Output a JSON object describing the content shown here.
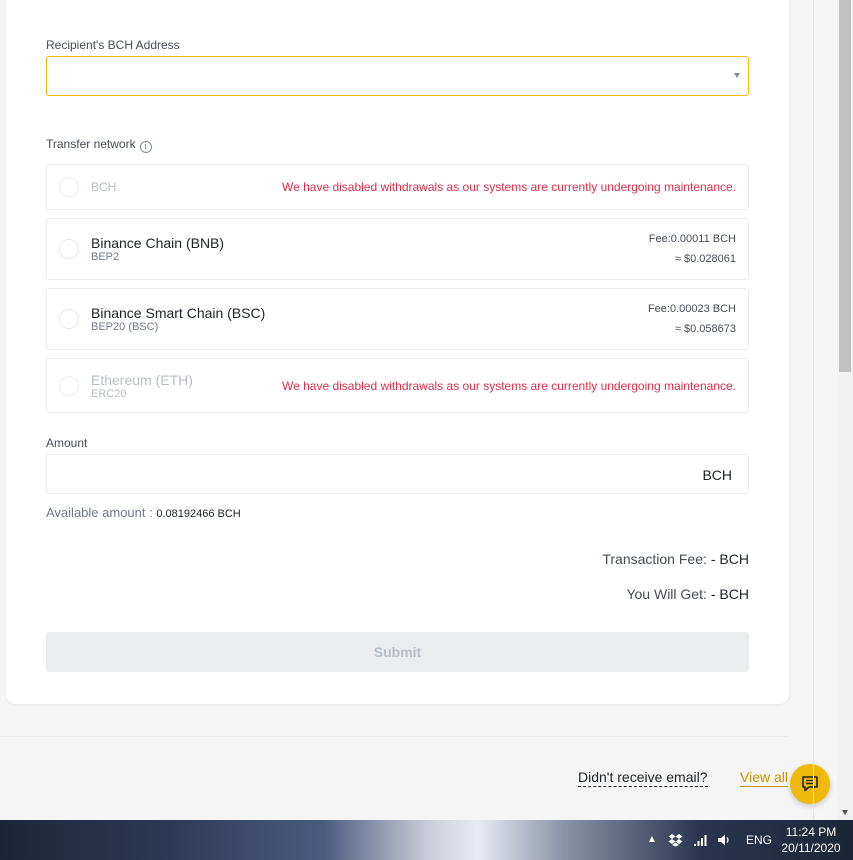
{
  "form": {
    "address_label": "Recipient's BCH Address",
    "address_value": "",
    "network_label": "Transfer network",
    "networks": [
      {
        "name": "BCH",
        "sub": "",
        "disabled": true,
        "warning": "We have disabled withdrawals as our systems are currently undergoing maintenance.",
        "fee": "",
        "fee_usd": ""
      },
      {
        "name": "Binance Chain (BNB)",
        "sub": "BEP2",
        "disabled": false,
        "warning": "",
        "fee": "Fee:0.00011 BCH",
        "fee_usd": "≈ $0.028061"
      },
      {
        "name": "Binance Smart Chain (BSC)",
        "sub": "BEP20 (BSC)",
        "disabled": false,
        "warning": "",
        "fee": "Fee:0.00023 BCH",
        "fee_usd": "≈ $0.058673"
      },
      {
        "name": "Ethereum (ETH)",
        "sub": "ERC20",
        "disabled": true,
        "warning": "We have disabled withdrawals as our systems are currently undergoing maintenance.",
        "fee": "",
        "fee_usd": ""
      }
    ],
    "amount_label": "Amount",
    "amount_unit": "BCH",
    "available_label": "Available amount :",
    "available_value": "0.08192466 BCH",
    "tx_fee_label": "Transaction Fee:",
    "tx_fee_value": "- BCH",
    "you_get_label": "You Will Get:",
    "you_get_value": "- BCH",
    "submit_label": "Submit"
  },
  "footer": {
    "email_link": "Didn't receive email?",
    "view_all_link": "View all"
  },
  "taskbar": {
    "language": "ENG",
    "time": "11:24 PM",
    "date": "20/11/2020"
  },
  "colors": {
    "accent": "#f0b90b",
    "warning": "#d9304e",
    "link": "#c99400"
  }
}
